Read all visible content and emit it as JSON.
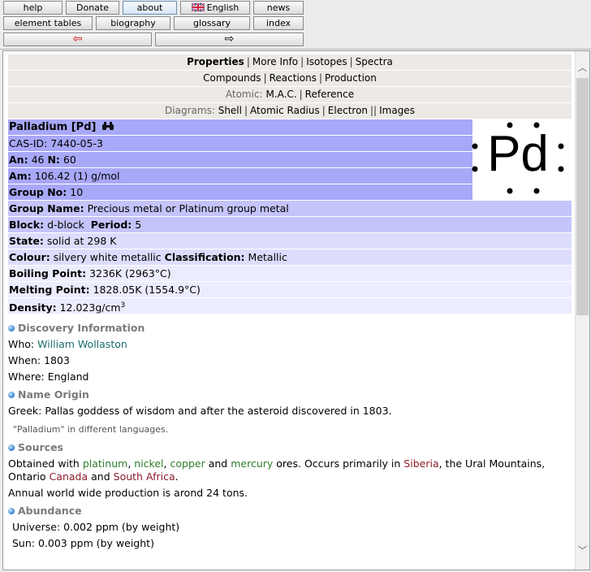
{
  "toolbar": {
    "help": "help",
    "donate": "Donate",
    "about": "about",
    "language": "English",
    "news": "news",
    "element_tables": "element tables",
    "biography": "biography",
    "glossary": "glossary",
    "index": "index",
    "back_arrow": "⇦",
    "forward_arrow": "⇨"
  },
  "nav": {
    "row1": [
      "Properties",
      "More Info",
      "Isotopes",
      "Spectra"
    ],
    "row2": [
      "Compounds",
      "Reactions",
      "Production"
    ],
    "row3_label": "Atomic:",
    "row3": [
      "M.A.C.",
      "Reference"
    ],
    "row4_label": "Diagrams:",
    "row4": [
      "Shell",
      "Atomic Radius",
      "Electron"
    ],
    "row4_extra": "Images",
    "sep": "|",
    "dsep": "||"
  },
  "element": {
    "title": "Palladium [Pd]",
    "symbol": "Pd",
    "cas_label": "CAS-ID:",
    "cas": "7440-05-3",
    "an_label": "An:",
    "an": "46",
    "n_label": "N:",
    "n": "60",
    "am_label": "Am:",
    "am": "106.42 (1) g/mol",
    "group_no_label": "Group No:",
    "group_no": "10",
    "group_name_label": "Group Name:",
    "group_name": "Precious metal or Platinum group metal",
    "block_label": "Block:",
    "block": "d-block",
    "period_label": "Period:",
    "period": "5",
    "state_label": "State:",
    "state": "solid at 298 K",
    "colour_label": "Colour:",
    "colour": "silvery white metallic",
    "class_label": "Classification:",
    "class": "Metallic",
    "bp_label": "Boiling Point:",
    "bp": "3236K (2963°C)",
    "mp_label": "Melting Point:",
    "mp": "1828.05K (1554.9°C)",
    "density_label": "Density:",
    "density": "12.023g/cm",
    "density_sup": "3"
  },
  "discovery": {
    "heading": "Discovery Information",
    "who_label": "Who:",
    "who": "William Wollaston",
    "when_label": "When:",
    "when": "1803",
    "where_label": "Where:",
    "where": "England"
  },
  "name_origin": {
    "heading": "Name Origin",
    "text": "Greek: Pallas goddess of wisdom and after the asteroid discovered in 1803.",
    "languages": "\"Palladium\" in different languages."
  },
  "sources": {
    "heading": "Sources",
    "t1": "Obtained with",
    "platinum": "platinum",
    "c1": ",",
    "nickel": "nickel",
    "c2": ",",
    "copper": "copper",
    "t2": "and",
    "mercury": "mercury",
    "t3": "ores. Occurs primarily in",
    "siberia": "Siberia",
    "t4": ", the Ural Mountains, Ontario",
    "canada": "Canada",
    "t5": "and",
    "south_africa": "South Africa",
    "t6": ".",
    "production": "Annual world wide production is arond 24 tons."
  },
  "abundance": {
    "heading": "Abundance",
    "universe": "Universe: 0.002 ppm (by weight)",
    "sun": "Sun: 0.003 ppm (by weight)"
  },
  "colors": {
    "accent_blue": "#a8a8f8",
    "link_teal": "#1a6b6b",
    "link_green": "#2e7d2e",
    "link_maroon": "#8b1c2b"
  }
}
